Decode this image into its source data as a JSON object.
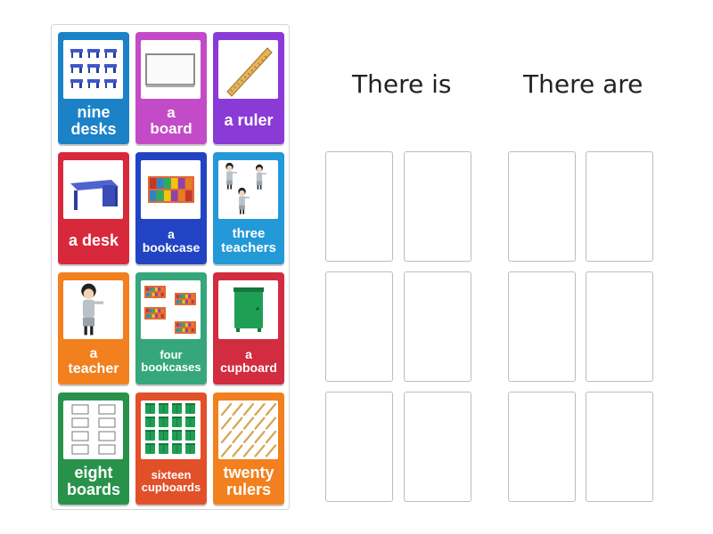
{
  "columns": {
    "left": "There is",
    "right": "There are"
  },
  "cards": [
    {
      "label": "nine\ndesks",
      "color": "#1b82c8",
      "icon": "desks-icon"
    },
    {
      "label": "a\nboard",
      "color": "#c44bc7",
      "icon": "board-icon"
    },
    {
      "label": "a ruler",
      "color": "#8a3ad6",
      "icon": "ruler-icon"
    },
    {
      "label": "a desk",
      "color": "#d8283c",
      "icon": "desk-icon"
    },
    {
      "label": "a\nbookcase",
      "color": "#2244c4",
      "icon": "bookcase-icon"
    },
    {
      "label": "three\nteachers",
      "color": "#2399d8",
      "icon": "teachers-icon"
    },
    {
      "label": "a\nteacher",
      "color": "#f2801e",
      "icon": "teacher-icon"
    },
    {
      "label": "four\nbookcases",
      "color": "#36a77c",
      "icon": "bookcases-icon"
    },
    {
      "label": "a\ncupboard",
      "color": "#d22c40",
      "icon": "cupboard-icon"
    },
    {
      "label": "eight\nboards",
      "color": "#28924a",
      "icon": "boards-icon"
    },
    {
      "label": "sixteen\ncupboards",
      "color": "#e2502a",
      "icon": "cupboards-icon"
    },
    {
      "label": "twenty\nrulers",
      "color": "#f2801e",
      "icon": "rulers-icon"
    }
  ]
}
